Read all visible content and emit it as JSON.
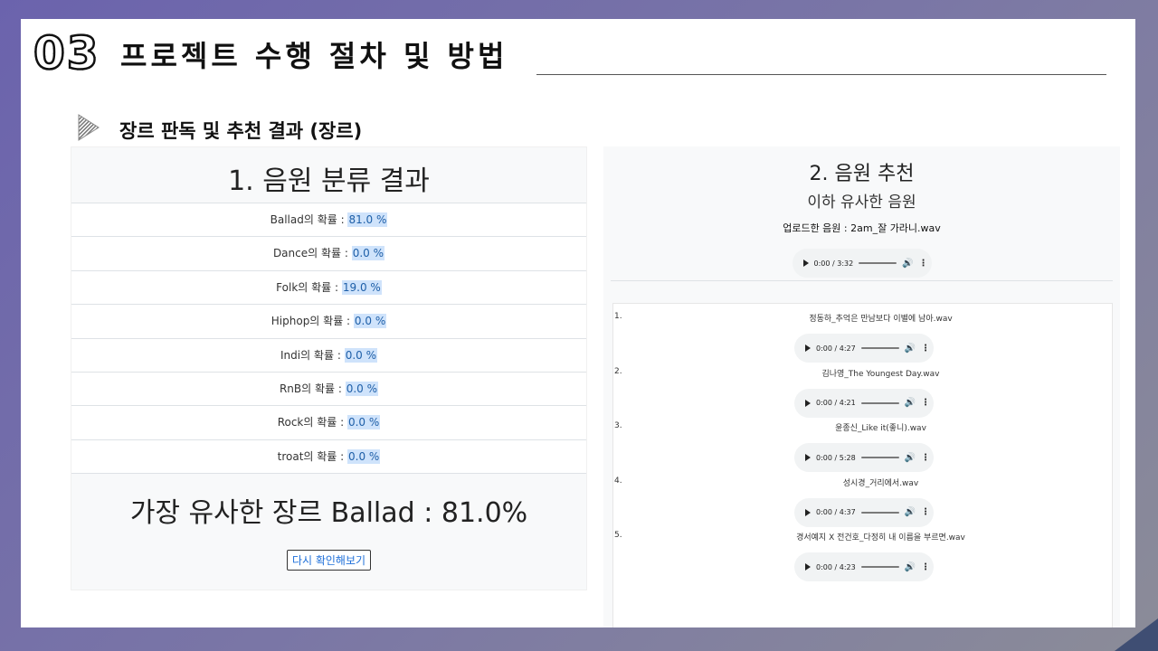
{
  "slide": {
    "number": "03",
    "title": "프로젝트 수행 절차 및 방법",
    "section_title": "장르 판독 및 추천 결과 (장르)"
  },
  "left": {
    "header": "1. 음원 분류 결과",
    "probabilities": [
      {
        "label": "Ballad의 확률 : ",
        "value": "81.0 %"
      },
      {
        "label": "Dance의 확률 : ",
        "value": "0.0 %"
      },
      {
        "label": "Folk의 확률 : ",
        "value": "19.0 %"
      },
      {
        "label": "Hiphop의 확률 : ",
        "value": "0.0 %"
      },
      {
        "label": "Indi의 확률 : ",
        "value": "0.0 %"
      },
      {
        "label": "RnB의 확률 : ",
        "value": "0.0 %"
      },
      {
        "label": "Rock의 확률 : ",
        "value": "0.0 %"
      },
      {
        "label": "troat의 확률 : ",
        "value": "0.0 %"
      }
    ],
    "summary": "가장 유사한 장르 Ballad : 81.0%",
    "retry_button": "다시 확인해보기"
  },
  "right": {
    "title": "2. 음원 추천",
    "subtitle": "이하 유사한 음원",
    "uploaded": "업로드한 음원 : 2am_잘 가라니.wav",
    "uploaded_time": "0:00 / 3:32",
    "recommendations": [
      {
        "num": "1.",
        "name": "정동하_추억은 만남보다 이별에 남아.wav",
        "time": "0:00 / 4:27"
      },
      {
        "num": "2.",
        "name": "김나영_The Youngest Day.wav",
        "time": "0:00 / 4:21"
      },
      {
        "num": "3.",
        "name": "윤종신_Like it(좋니).wav",
        "time": "0:00 / 5:28"
      },
      {
        "num": "4.",
        "name": "성시경_거리에서.wav",
        "time": "0:00 / 4:37"
      },
      {
        "num": "5.",
        "name": "경서예지 X 전건호_다정히 내 이름을 부르면.wav",
        "time": "0:00 / 4:23"
      }
    ]
  },
  "icons": {
    "play": "play-icon",
    "volume": "volume-icon",
    "more": "more-options-icon",
    "section_bullet": "triangle-arrow-icon"
  }
}
